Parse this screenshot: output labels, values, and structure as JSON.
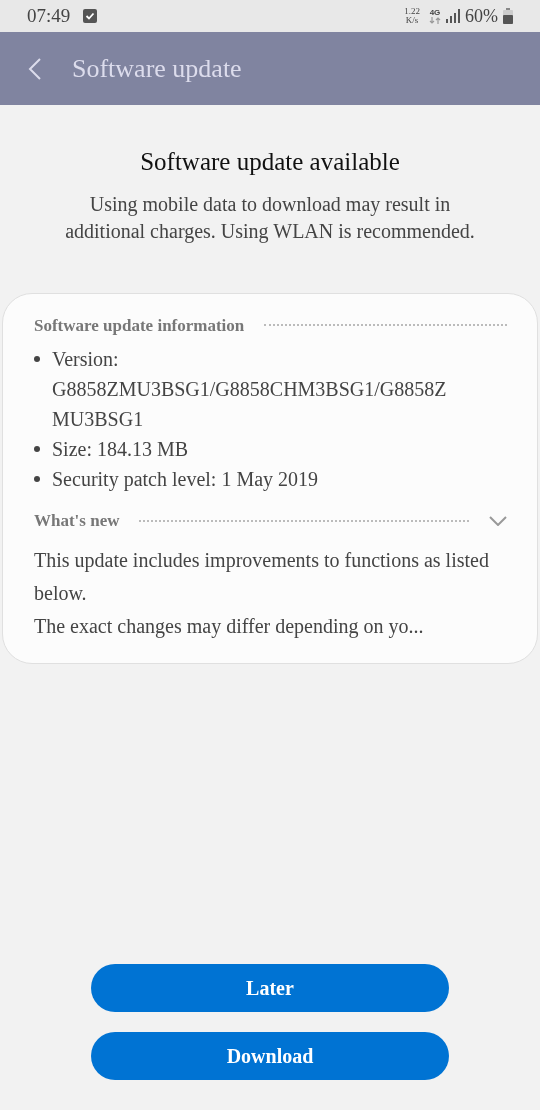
{
  "status_bar": {
    "time": "07:49",
    "speed_value": "1.22",
    "speed_unit": "K/s",
    "network": "4G",
    "battery": "60%"
  },
  "header": {
    "title": "Software update"
  },
  "heading": "Software update available",
  "notice": "Using mobile data to download may result in additional charges. Using WLAN is recommended.",
  "info_card": {
    "info_title": "Software update information",
    "items": [
      "Version: G8858ZMU3BSG1/G8858CHM3BSG1/G8858ZMU3BSG1",
      "Size: 184.13 MB",
      "Security patch level: 1 May 2019"
    ],
    "whats_new": {
      "title": "What's new",
      "expanded": false,
      "paragraphs": [
        "This update includes improvements to functions as listed below.",
        "The exact changes may differ depending on yo..."
      ]
    }
  },
  "buttons": [
    "Later",
    "Download"
  ]
}
